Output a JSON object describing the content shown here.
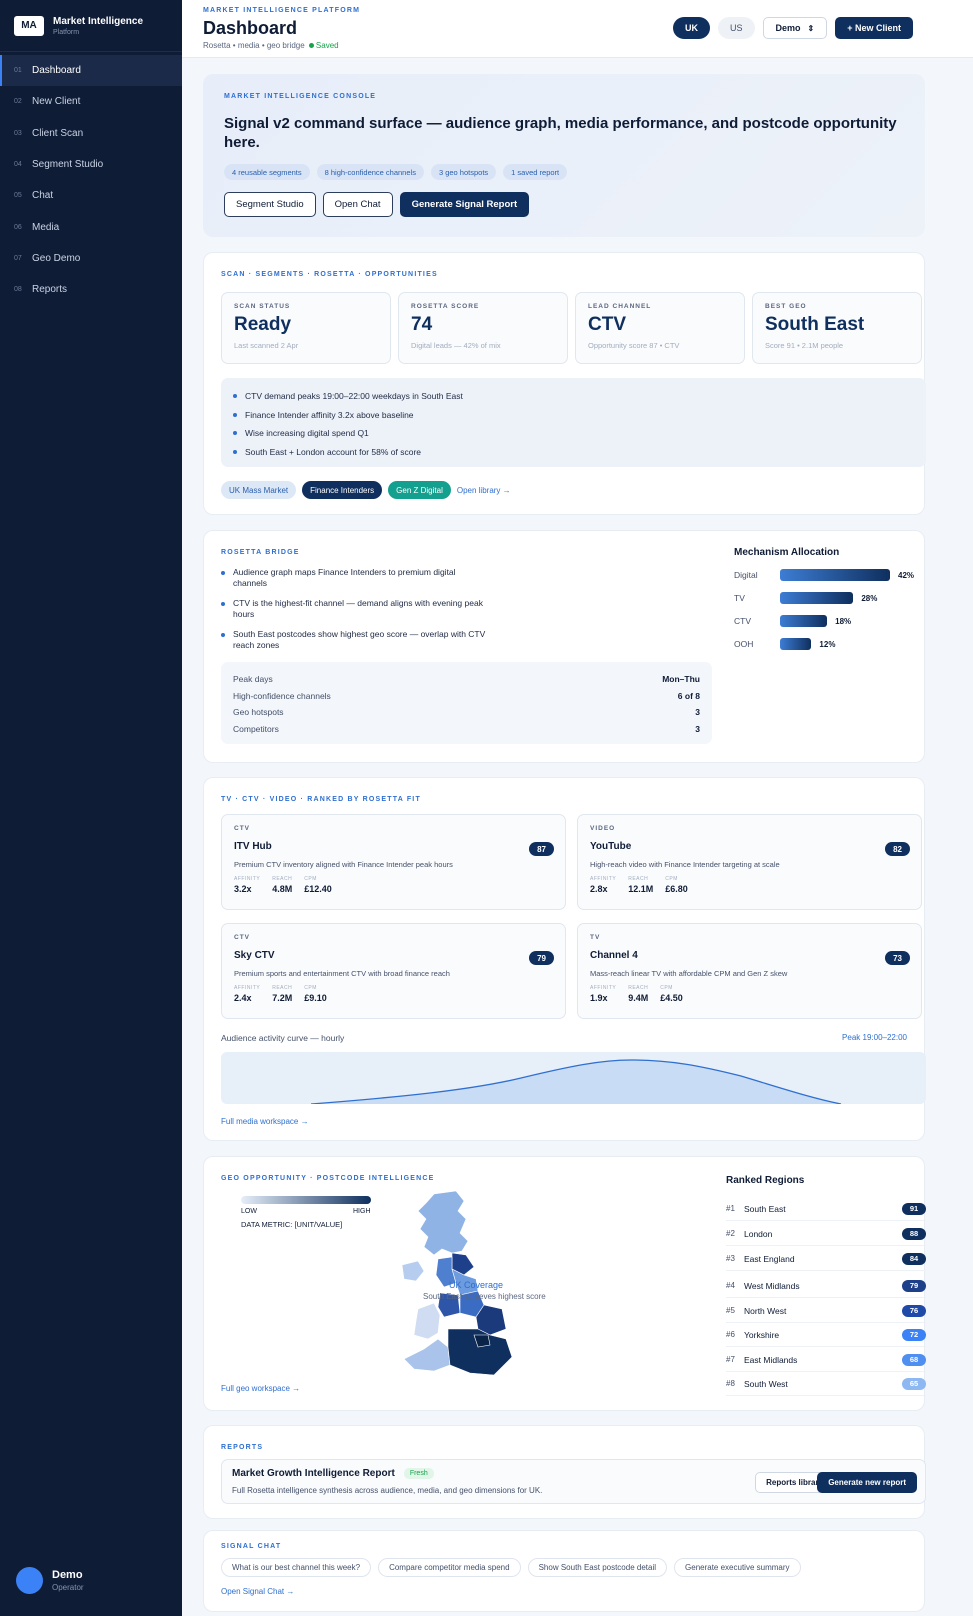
{
  "sidebar": {
    "badge": "MA",
    "title": "Market Intelligence",
    "subtitle": "Platform",
    "items": [
      {
        "num": "01",
        "label": "Dashboard"
      },
      {
        "num": "02",
        "label": "New Client"
      },
      {
        "num": "03",
        "label": "Client Scan"
      },
      {
        "num": "04",
        "label": "Segment Studio"
      },
      {
        "num": "05",
        "label": "Chat"
      },
      {
        "num": "06",
        "label": "Media"
      },
      {
        "num": "07",
        "label": "Geo Demo"
      },
      {
        "num": "08",
        "label": "Reports"
      }
    ],
    "user": {
      "name": "Demo",
      "role": "Operator"
    }
  },
  "header": {
    "eyebrow": "MARKET INTELLIGENCE PLATFORM",
    "title": "Dashboard",
    "breadcrumb": "Rosetta • media • geo bridge",
    "saved": "Saved",
    "region_uk": "UK",
    "region_us": "US",
    "mode": "Demo",
    "new_client": "+ New Client"
  },
  "hero": {
    "eyebrow": "MARKET INTELLIGENCE CONSOLE",
    "headline": "Signal v2 command surface — audience graph, media performance, and postcode opportunity here.",
    "chips": [
      "4 reusable segments",
      "8 high-confidence channels",
      "3 geo hotspots",
      "1 saved report"
    ],
    "buttons": {
      "segment": "Segment Studio",
      "chat": "Open Chat",
      "report": "Generate Signal Report"
    }
  },
  "scan": {
    "eyebrow": "SCAN · SEGMENTS · ROSETTA · OPPORTUNITIES",
    "kpis": [
      {
        "label": "SCAN STATUS",
        "value": "Ready",
        "sub": "Last scanned 2 Apr"
      },
      {
        "label": "ROSETTA SCORE",
        "value": "74",
        "sub": "Digital leads — 42% of mix"
      },
      {
        "label": "LEAD CHANNEL",
        "value": "CTV",
        "sub": "Opportunity score 87 • CTV"
      },
      {
        "label": "BEST GEO",
        "value": "South East",
        "sub": "Score 91 • 2.1M people"
      }
    ],
    "signals": [
      "CTV demand peaks 19:00–22:00 weekdays in South East",
      "Finance Intender affinity 3.2x above baseline",
      "Wise increasing digital spend Q1",
      "South East + London account for 58% of score"
    ],
    "tags": [
      "UK Mass Market",
      "Finance Intenders",
      "Gen Z Digital"
    ],
    "library_link": "Open library →"
  },
  "bridge": {
    "eyebrow": "ROSETTA BRIDGE",
    "bullets": [
      "Audience graph maps Finance Intenders to premium digital channels",
      "CTV is the highest-fit channel — demand aligns with evening peak hours",
      "South East postcodes show highest geo score — overlap with CTV reach zones"
    ],
    "stats": [
      {
        "label": "Peak days",
        "value": "Mon–Thu"
      },
      {
        "label": "High-confidence channels",
        "value": "6 of 8"
      },
      {
        "label": "Geo hotspots",
        "value": "3"
      },
      {
        "label": "Competitors",
        "value": "3"
      }
    ],
    "mechanism_title": "Mechanism Allocation",
    "mechanism": [
      {
        "label": "Digital",
        "pct": 42,
        "text": "42%"
      },
      {
        "label": "TV",
        "pct": 28,
        "text": "28%"
      },
      {
        "label": "CTV",
        "pct": 18,
        "text": "18%"
      },
      {
        "label": "OOH",
        "pct": 12,
        "text": "12%"
      }
    ]
  },
  "media": {
    "eyebrow": "TV · CTV · VIDEO · RANKED BY ROSETTA FIT",
    "metric_labels": {
      "affinity": "AFFINITY",
      "reach": "REACH",
      "cpm": "CPM"
    },
    "cards": [
      {
        "kind": "CTV",
        "name": "ITV Hub",
        "score": "87",
        "desc": "Premium CTV inventory aligned with Finance Intender peak hours",
        "affinity": "3.2x",
        "reach": "4.8M",
        "cpm": "£12.40"
      },
      {
        "kind": "VIDEO",
        "name": "YouTube",
        "score": "82",
        "desc": "High-reach video with Finance Intender targeting at scale",
        "affinity": "2.8x",
        "reach": "12.1M",
        "cpm": "£6.80"
      },
      {
        "kind": "CTV",
        "name": "Sky CTV",
        "score": "79",
        "desc": "Premium sports and entertainment CTV with broad finance reach",
        "affinity": "2.4x",
        "reach": "7.2M",
        "cpm": "£9.10"
      },
      {
        "kind": "TV",
        "name": "Channel 4",
        "score": "73",
        "desc": "Mass-reach linear TV with affordable CPM and Gen Z skew",
        "affinity": "1.9x",
        "reach": "9.4M",
        "cpm": "£4.50"
      }
    ],
    "curve_label": "Audience activity curve — hourly",
    "curve_peak": "Peak 19:00–22:00",
    "link": "Full media workspace →"
  },
  "geo": {
    "eyebrow": "GEO OPPORTUNITY · POSTCODE INTELLIGENCE",
    "legend_low": "LOW",
    "legend_high": "HIGH",
    "legend_metric": "DATA METRIC: [UNIT/VALUE]",
    "map_overlay_1": "UK Coverage",
    "map_overlay_2": "South East achieves highest score",
    "link": "Full geo workspace →",
    "ranked_title": "Ranked Regions",
    "regions": [
      {
        "rank": "#1",
        "name": "South East",
        "score": "91",
        "color": "#0f2f5e"
      },
      {
        "rank": "#2",
        "name": "London",
        "score": "88",
        "color": "#0f2f5e"
      },
      {
        "rank": "#3",
        "name": "East England",
        "score": "84",
        "color": "#0f2f5e"
      },
      {
        "rank": "#4",
        "name": "West Midlands",
        "score": "79",
        "color": "#1e3f8a"
      },
      {
        "rank": "#5",
        "name": "North West",
        "score": "76",
        "color": "#1f4aa8"
      },
      {
        "rank": "#6",
        "name": "Yorkshire",
        "score": "72",
        "color": "#3b82f6"
      },
      {
        "rank": "#7",
        "name": "East Midlands",
        "score": "68",
        "color": "#4f8ff0"
      },
      {
        "rank": "#8",
        "name": "South West",
        "score": "65",
        "color": "#8db8f2"
      }
    ]
  },
  "reports": {
    "eyebrow": "REPORTS",
    "title": "Market Growth Intelligence Report",
    "badge": "Fresh",
    "desc": "Full Rosetta intelligence synthesis across audience, media, and geo dimensions for UK.",
    "library": "Reports library",
    "generate": "Generate new report"
  },
  "chat": {
    "eyebrow": "SIGNAL CHAT",
    "prompts": [
      "What is our best channel this week?",
      "Compare competitor media spend",
      "Show South East postcode detail",
      "Generate executive summary"
    ],
    "link": "Open Signal Chat →"
  },
  "icons": {
    "avatar": "avatar-circle",
    "mode": "chevron-updown-icon"
  }
}
